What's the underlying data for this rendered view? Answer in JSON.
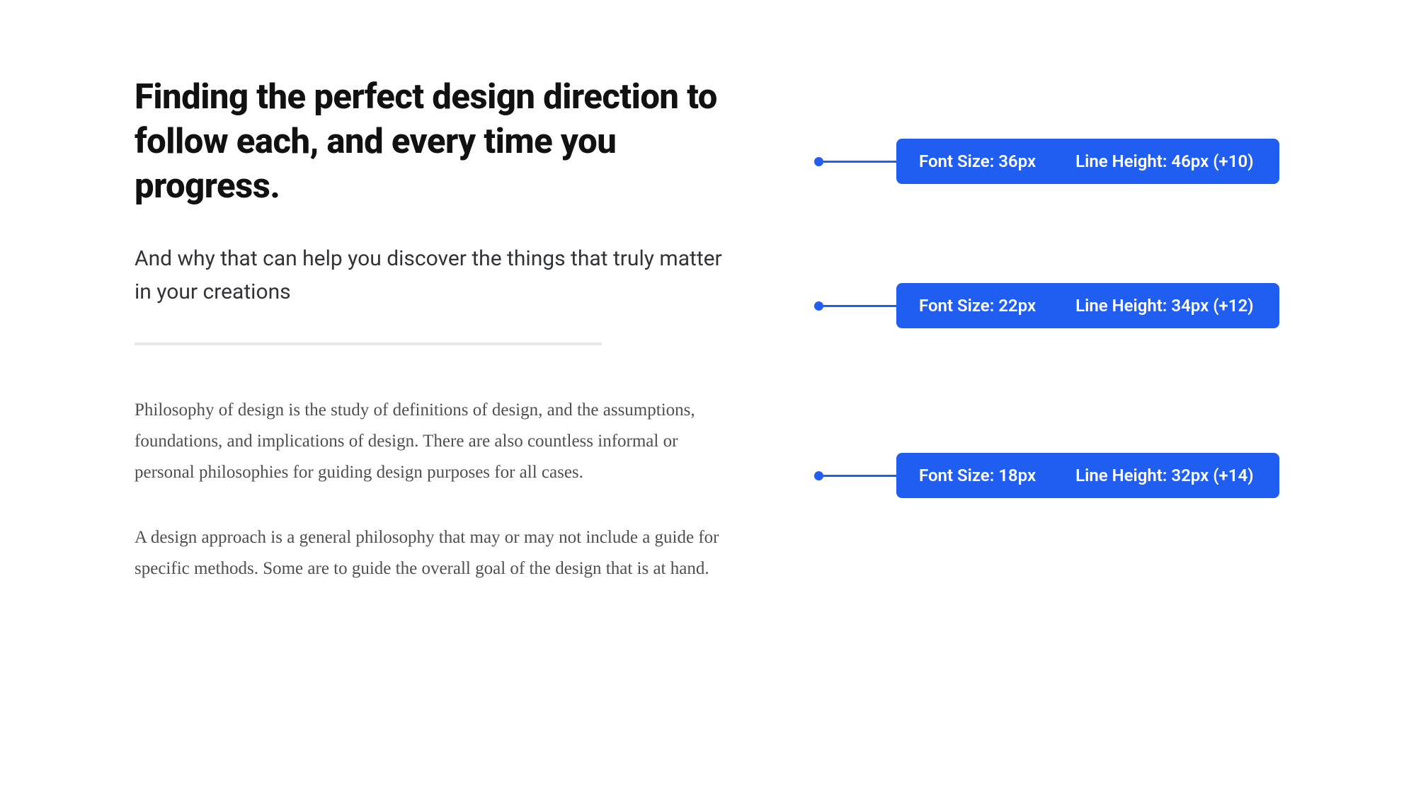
{
  "content": {
    "heading": "Finding the perfect design direction to follow each, and every time you progress.",
    "subheading": "And why that can help you discover the things that truly matter in your creations",
    "paragraph1": "Philosophy of design is the study of definitions of design, and the assumptions, foundations, and implications of design. There are also countless informal or personal philosophies for guiding design purposes for all cases.",
    "paragraph2": "A design approach is a general philosophy that may or may not include a guide for specific methods. Some are to guide the overall goal of the design that is at hand."
  },
  "annotations": [
    {
      "font_size_label": "Font Size: 36px",
      "line_height_label": "Line Height: 46px (+10)"
    },
    {
      "font_size_label": "Font Size: 22px",
      "line_height_label": "Line Height: 34px (+12)"
    },
    {
      "font_size_label": "Font Size: 18px",
      "line_height_label": "Line Height: 32px (+14)"
    }
  ]
}
